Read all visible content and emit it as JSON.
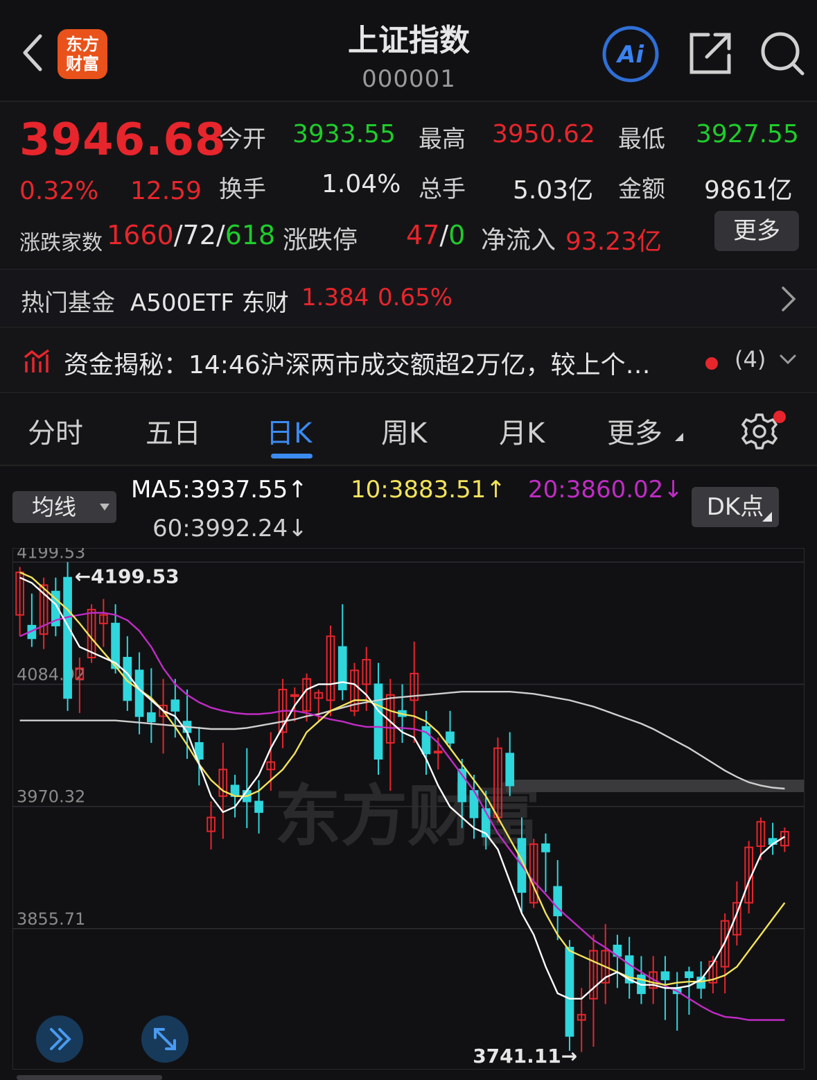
{
  "header": {
    "logo_line1": "东方",
    "logo_line2": "财富",
    "title": "上证指数",
    "code": "000001"
  },
  "quote": {
    "price": "3946.68",
    "change_pct": "0.32%",
    "change": "12.59",
    "open_label": "今开",
    "open": "3933.55",
    "high_label": "最高",
    "high": "3950.62",
    "low_label": "最低",
    "low": "3927.55",
    "turnover_label": "换手",
    "turnover": "1.04%",
    "volume_label": "总手",
    "volume": "5.03亿",
    "amount_label": "金额",
    "amount": "9861亿",
    "breadth_label": "涨跌家数",
    "breadth_up": "1660",
    "breadth_flat": "72",
    "breadth_down": "618",
    "limit_label": "涨跌停",
    "limit_up": "47",
    "limit_down": "0",
    "flow_label": "净流入",
    "flow": "93.23亿",
    "more_label": "更多"
  },
  "fund": {
    "label": "热门基金",
    "name": "A500ETF 东财",
    "price": "1.384",
    "pct": "0.65%"
  },
  "news": {
    "text": "资金揭秘：14:46沪深两市成交额超2万亿，较上个…",
    "count": "(4)"
  },
  "tabs": [
    {
      "label": "分时"
    },
    {
      "label": "五日"
    },
    {
      "label": "日K"
    },
    {
      "label": "周K"
    },
    {
      "label": "月K"
    },
    {
      "label": "更多"
    }
  ],
  "ma": {
    "select_label": "均线",
    "ma5": "MA5:3937.55↑",
    "ma10": "10:3883.51↑",
    "ma20": "20:3860.02↓",
    "ma60": "60:3992.24↓",
    "dk_label": "DK点"
  },
  "colors": {
    "up": "#e6262c",
    "down": "#1fcc2c",
    "candle_up": "#e6262c",
    "candle_down": "#2fd6dc",
    "ma5": "#ffffff",
    "ma10": "#f3e35a",
    "ma20": "#c02cc4",
    "ma60": "#cfcfcf"
  },
  "chart_data": {
    "type": "candlestick",
    "y_ticks": [
      "4199.53",
      "4084.92",
      "3970.32",
      "3855.71"
    ],
    "ylim": [
      3730,
      4205
    ],
    "watermark": "东方财富",
    "max_label": "4199.53",
    "min_label": "3741.11",
    "candles": [
      {
        "o": 4150,
        "h": 4195,
        "l": 4130,
        "c": 4190
      },
      {
        "o": 4140,
        "h": 4170,
        "l": 4120,
        "c": 4128
      },
      {
        "o": 4132,
        "h": 4185,
        "l": 4118,
        "c": 4178
      },
      {
        "o": 4172,
        "h": 4185,
        "l": 4130,
        "c": 4140
      },
      {
        "o": 4185,
        "h": 4199.53,
        "l": 4060,
        "c": 4072
      },
      {
        "o": 4090,
        "h": 4110,
        "l": 4058,
        "c": 4100
      },
      {
        "o": 4110,
        "h": 4160,
        "l": 4105,
        "c": 4155
      },
      {
        "o": 4142,
        "h": 4165,
        "l": 4120,
        "c": 4150
      },
      {
        "o": 4142,
        "h": 4160,
        "l": 4095,
        "c": 4100
      },
      {
        "o": 4110,
        "h": 4130,
        "l": 4060,
        "c": 4070
      },
      {
        "o": 4098,
        "h": 4115,
        "l": 4038,
        "c": 4055
      },
      {
        "o": 4058,
        "h": 4100,
        "l": 4030,
        "c": 4050
      },
      {
        "o": 4055,
        "h": 4090,
        "l": 4020,
        "c": 4065
      },
      {
        "o": 4070,
        "h": 4090,
        "l": 4035,
        "c": 4060
      },
      {
        "o": 4050,
        "h": 4080,
        "l": 4015,
        "c": 4040
      },
      {
        "o": 4030,
        "h": 4045,
        "l": 3990,
        "c": 4015
      },
      {
        "o": 3947,
        "h": 3975,
        "l": 3930,
        "c": 3960
      },
      {
        "o": 3980,
        "h": 4030,
        "l": 3940,
        "c": 4005
      },
      {
        "o": 3990,
        "h": 4000,
        "l": 3960,
        "c": 3980
      },
      {
        "o": 3985,
        "h": 4025,
        "l": 3950,
        "c": 3975
      },
      {
        "o": 3975,
        "h": 3995,
        "l": 3945,
        "c": 3965
      },
      {
        "o": 4005,
        "h": 4040,
        "l": 3985,
        "c": 4012
      },
      {
        "o": 4040,
        "h": 4090,
        "l": 4025,
        "c": 4080
      },
      {
        "o": 4075,
        "h": 4082,
        "l": 4050,
        "c": 4075
      },
      {
        "o": 4060,
        "h": 4095,
        "l": 4050,
        "c": 4090
      },
      {
        "o": 4072,
        "h": 4080,
        "l": 4050,
        "c": 4077
      },
      {
        "o": 4070,
        "h": 4140,
        "l": 4055,
        "c": 4130
      },
      {
        "o": 4120,
        "h": 4160,
        "l": 4070,
        "c": 4080
      },
      {
        "o": 4060,
        "h": 4105,
        "l": 4055,
        "c": 4098
      },
      {
        "o": 4085,
        "h": 4120,
        "l": 4060,
        "c": 4108
      },
      {
        "o": 4085,
        "h": 4105,
        "l": 4000,
        "c": 4015
      },
      {
        "o": 4030,
        "h": 4090,
        "l": 3985,
        "c": 4075
      },
      {
        "o": 4060,
        "h": 4085,
        "l": 4030,
        "c": 4055
      },
      {
        "o": 4070,
        "h": 4125,
        "l": 4030,
        "c": 4095
      },
      {
        "o": 4045,
        "h": 4060,
        "l": 4000,
        "c": 4020
      },
      {
        "o": 4022,
        "h": 4035,
        "l": 4005,
        "c": 4022
      },
      {
        "o": 4040,
        "h": 4060,
        "l": 4025,
        "c": 4030
      },
      {
        "o": 4005,
        "h": 4015,
        "l": 3950,
        "c": 3975
      },
      {
        "o": 3985,
        "h": 4000,
        "l": 3940,
        "c": 3960
      },
      {
        "o": 3968,
        "h": 3985,
        "l": 3930,
        "c": 3942
      },
      {
        "o": 3960,
        "h": 4035,
        "l": 3955,
        "c": 4025
      },
      {
        "o": 4020,
        "h": 4040,
        "l": 3980,
        "c": 3990
      },
      {
        "o": 3940,
        "h": 3960,
        "l": 3870,
        "c": 3890
      },
      {
        "o": 3880,
        "h": 3940,
        "l": 3875,
        "c": 3935
      },
      {
        "o": 3935,
        "h": 3945,
        "l": 3890,
        "c": 3928
      },
      {
        "o": 3895,
        "h": 3920,
        "l": 3845,
        "c": 3868
      },
      {
        "o": 3838,
        "h": 3845,
        "l": 3741.11,
        "c": 3755
      },
      {
        "o": 3770,
        "h": 3800,
        "l": 3740,
        "c": 3775
      },
      {
        "o": 3790,
        "h": 3850,
        "l": 3745,
        "c": 3835
      },
      {
        "o": 3805,
        "h": 3860,
        "l": 3785,
        "c": 3835
      },
      {
        "o": 3840,
        "h": 3850,
        "l": 3800,
        "c": 3830
      },
      {
        "o": 3830,
        "h": 3848,
        "l": 3790,
        "c": 3805
      },
      {
        "o": 3812,
        "h": 3830,
        "l": 3785,
        "c": 3795
      },
      {
        "o": 3800,
        "h": 3830,
        "l": 3785,
        "c": 3815
      },
      {
        "o": 3815,
        "h": 3830,
        "l": 3770,
        "c": 3808
      },
      {
        "o": 3800,
        "h": 3815,
        "l": 3760,
        "c": 3795
      },
      {
        "o": 3815,
        "h": 3820,
        "l": 3775,
        "c": 3810
      },
      {
        "o": 3810,
        "h": 3825,
        "l": 3790,
        "c": 3800
      },
      {
        "o": 3805,
        "h": 3830,
        "l": 3795,
        "c": 3825
      },
      {
        "o": 3820,
        "h": 3870,
        "l": 3795,
        "c": 3863
      },
      {
        "o": 3850,
        "h": 3900,
        "l": 3840,
        "c": 3880
      },
      {
        "o": 3880,
        "h": 3938,
        "l": 3870,
        "c": 3932
      },
      {
        "o": 3933,
        "h": 3960,
        "l": 3920,
        "c": 3956
      },
      {
        "o": 3940,
        "h": 3955,
        "l": 3925,
        "c": 3935
      },
      {
        "o": 3933.55,
        "h": 3950.62,
        "l": 3927.55,
        "c": 3946.68
      }
    ],
    "ma5": [
      4185,
      4180,
      4170,
      4160,
      4140,
      4120,
      4115,
      4110,
      4105,
      4095,
      4080,
      4070,
      4060,
      4055,
      4040,
      4010,
      3980,
      3965,
      3970,
      3985,
      4000,
      4025,
      4045,
      4065,
      4080,
      4085,
      4085,
      4087,
      4085,
      4075,
      4060,
      4050,
      4040,
      4035,
      4015,
      3990,
      3970,
      3960,
      3950,
      3945,
      3930,
      3900,
      3870,
      3850,
      3820,
      3795,
      3790,
      3790,
      3800,
      3810,
      3815,
      3808,
      3803,
      3803,
      3800,
      3800,
      3802,
      3808,
      3823,
      3843,
      3870,
      3900,
      3925,
      3935,
      3942
    ],
    "ma10": [
      4190,
      4185,
      4175,
      4165,
      4155,
      4142,
      4128,
      4115,
      4102,
      4088,
      4080,
      4072,
      4060,
      4045,
      4028,
      4010,
      3995,
      3985,
      3980,
      3980,
      3985,
      3995,
      4005,
      4020,
      4040,
      4050,
      4060,
      4065,
      4070,
      4070,
      4065,
      4060,
      4057,
      4055,
      4050,
      4040,
      4025,
      4010,
      3995,
      3980,
      3960,
      3940,
      3920,
      3895,
      3870,
      3850,
      3835,
      3830,
      3825,
      3820,
      3815,
      3810,
      3808,
      3805,
      3803,
      3805,
      3806,
      3806,
      3808,
      3812,
      3820,
      3835,
      3850,
      3865,
      3880
    ],
    "ma20": [
      4130,
      4135,
      4140,
      4145,
      4148,
      4150,
      4152,
      4152,
      4150,
      4145,
      4135,
      4120,
      4100,
      4085,
      4075,
      4068,
      4063,
      4060,
      4058,
      4057,
      4057,
      4058,
      4060,
      4060,
      4058,
      4055,
      4052,
      4050,
      4047,
      4045,
      4045,
      4044,
      4044,
      4043,
      4040,
      4030,
      4015,
      4000,
      3985,
      3965,
      3945,
      3930,
      3915,
      3900,
      3888,
      3875,
      3865,
      3855,
      3845,
      3838,
      3830,
      3822,
      3815,
      3808,
      3802,
      3797,
      3790,
      3783,
      3777,
      3773,
      3772,
      3770,
      3770,
      3770,
      3770
    ],
    "ma60": [
      4051,
      4051,
      4051,
      4051,
      4051,
      4051,
      4051,
      4051,
      4051,
      4050,
      4049,
      4048,
      4047,
      4046,
      4045,
      4044,
      4043,
      4043,
      4043,
      4044,
      4046,
      4048,
      4050,
      4052,
      4055,
      4057,
      4060,
      4063,
      4066,
      4068,
      4070,
      4072,
      4073,
      4074,
      4075,
      4076,
      4077,
      4078,
      4078,
      4078,
      4078,
      4078,
      4077,
      4076,
      4074,
      4072,
      4070,
      4067,
      4064,
      4060,
      4056,
      4052,
      4048,
      4043,
      4037,
      4031,
      4025,
      4018,
      4011,
      4004,
      3998,
      3993,
      3990,
      3988,
      3987
    ]
  }
}
